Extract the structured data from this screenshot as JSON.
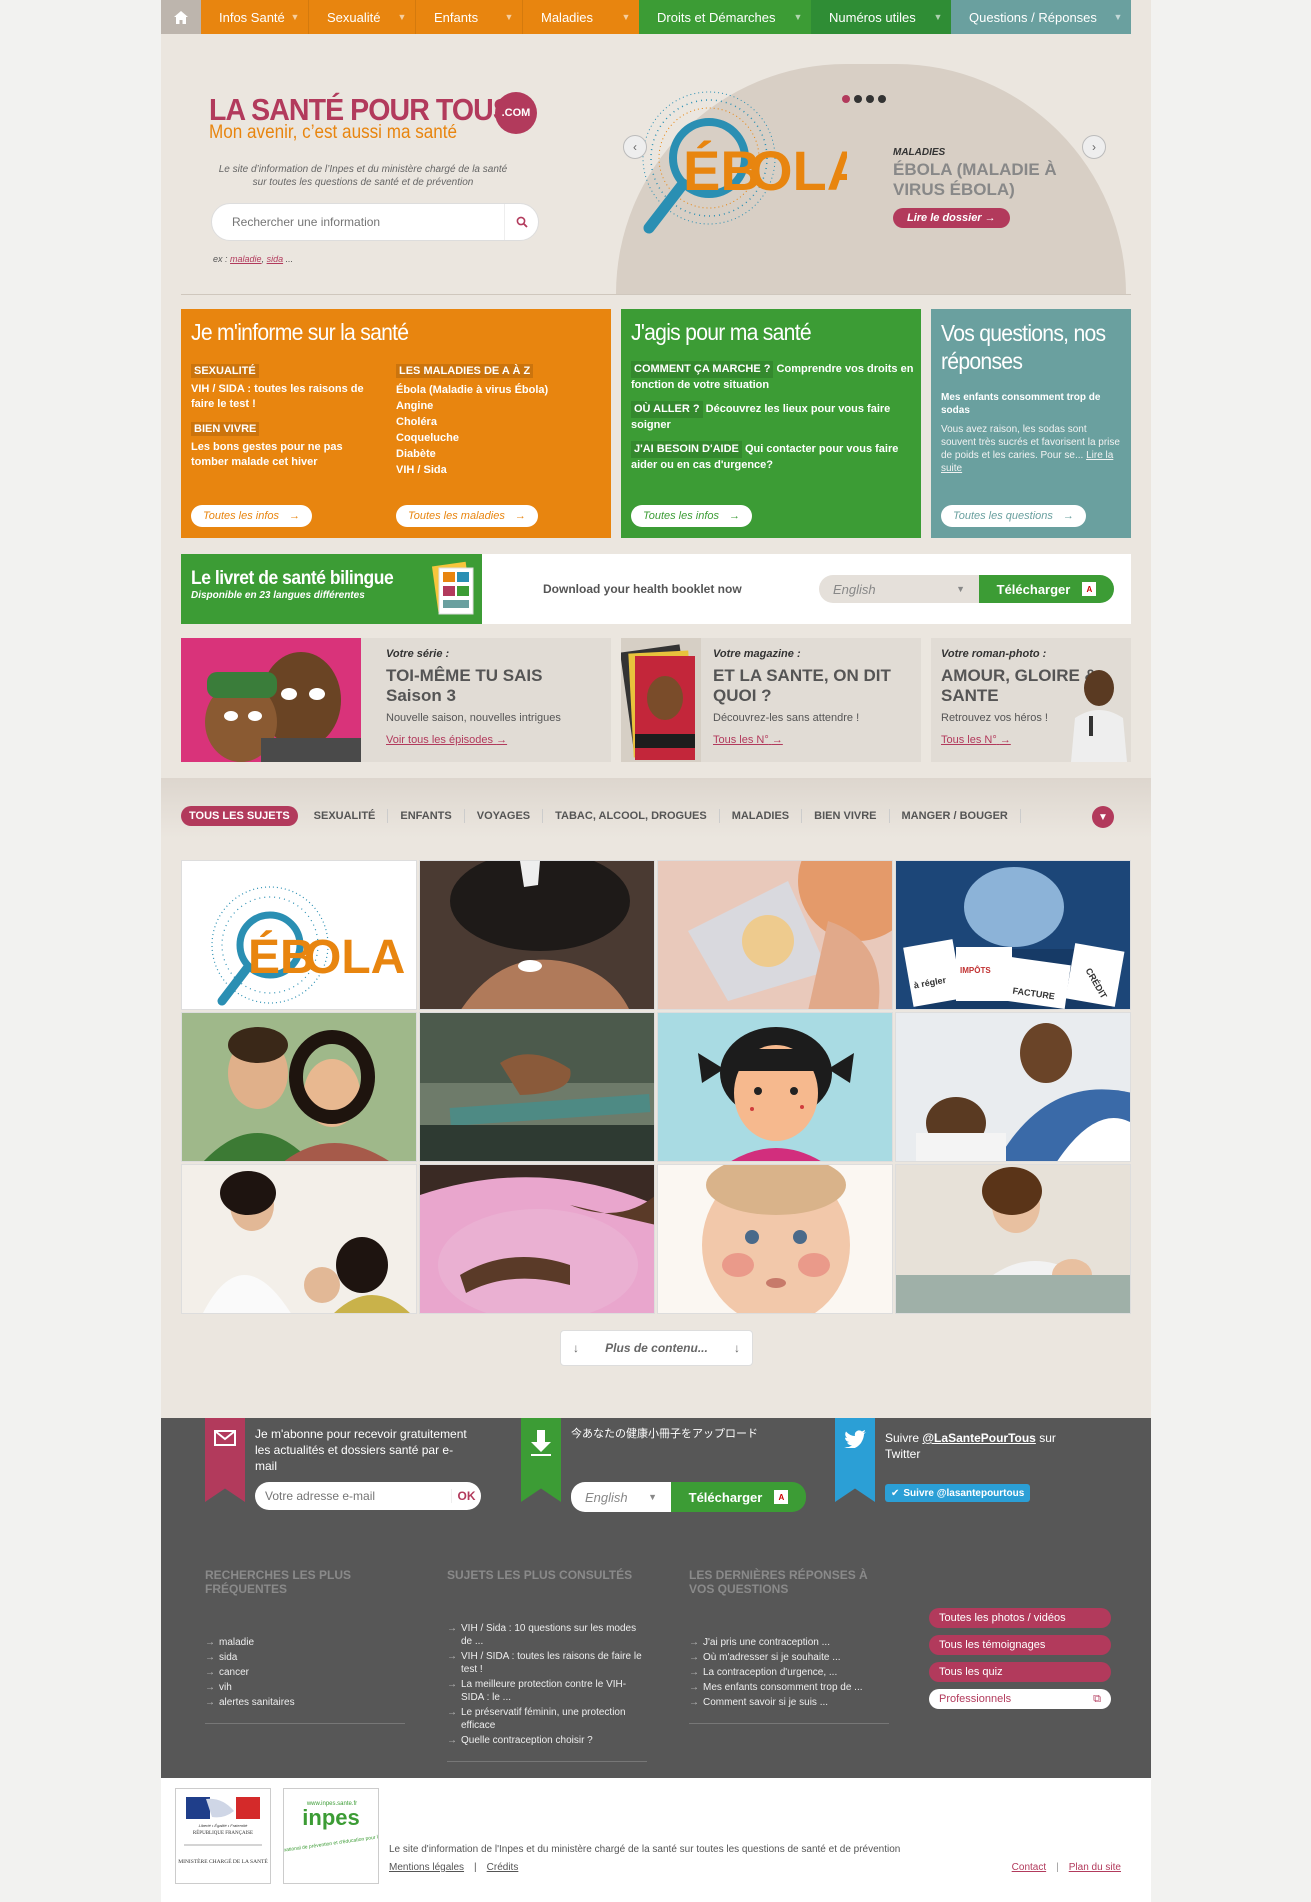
{
  "nav": {
    "items": [
      {
        "label": "Infos Santé",
        "color": "#e8850f"
      },
      {
        "label": "Sexualité",
        "color": "#e8850f"
      },
      {
        "label": "Enfants",
        "color": "#e8850f"
      },
      {
        "label": "Maladies",
        "color": "#e8850f"
      },
      {
        "label": "Droits et Démarches",
        "color": "#3c9c35"
      },
      {
        "label": "Numéros utiles",
        "color": "#2f8d35"
      },
      {
        "label": "Questions / Réponses",
        "color": "#6aa09f"
      }
    ]
  },
  "header": {
    "title": "LA SANTÉ POUR TOUS",
    "com": ".COM",
    "subtitle": "Mon avenir, c’est aussi ma santé",
    "tagline": "Le site d’information de l’Inpes et du ministère chargé de la santé sur toutes les questions de santé et de prévention",
    "search_placeholder": "Rechercher une information",
    "examples_prefix": "ex :",
    "example_1": "maladie",
    "example_2": "sida",
    "examples_suffix": "...",
    "hero": {
      "image_word_1": "ÉB",
      "image_word_2": "OLA",
      "kicker": "MALADIES",
      "title": "ÉBOLA (MALADIE À VIRUS ÉBOLA)",
      "cta": "Lire le dossier →"
    }
  },
  "blocks": {
    "inform": {
      "title": "Je m'informe sur la santé",
      "tag1": "SEXUALITÉ",
      "text1": "VIH / SIDA : toutes les raisons de faire le test !",
      "tag2": "BIEN VIVRE",
      "text2": "Les bons gestes pour ne pas tomber malade cet hiver",
      "tag3": "LES MALADIES DE A À Z",
      "diseases": [
        "Ébola (Maladie à virus Ébola)",
        "Angine",
        "Choléra",
        "Coqueluche",
        "Diabète",
        "VIH / Sida"
      ],
      "btn1": "Toutes les infos",
      "btn2": "Toutes les maladies"
    },
    "act": {
      "title": "J'agis pour ma santé",
      "tag1": "COMMENT ÇA MARCHE ?",
      "text1": "Comprendre vos droits en fonction de votre situation",
      "tag2": "OÙ ALLER ?",
      "text2": "Découvrez les lieux pour vous faire soigner",
      "tag3": "J'AI BESOIN D'AIDE",
      "text3": "Qui contacter pour vous faire aider ou en cas d'urgence?",
      "btn": "Toutes les infos"
    },
    "questions": {
      "title": "Vos questions, nos réponses",
      "question": "Mes enfants consomment trop de sodas",
      "answer": "Vous avez raison, les sodas sont souvent très sucrés et favorisent la prise de poids et les caries. Pour se...",
      "more": "Lire la suite",
      "btn": "Toutes les questions"
    }
  },
  "livret": {
    "title": "Le livret de santé bilingue",
    "subtitle": "Disponible en 23 langues différentes",
    "download_text": "Download your health booklet now",
    "language": "English",
    "button": "Télécharger"
  },
  "series": [
    {
      "kicker": "Votre série :",
      "title": "TOI-MÊME TU SAIS Saison 3",
      "desc": "Nouvelle saison, nouvelles intrigues",
      "link": "Voir tous les épisodes"
    },
    {
      "kicker": "Votre magazine :",
      "title": "ET LA SANTE, ON DIT QUOI ?",
      "desc": "Découvrez-les sans attendre !",
      "link": "Tous les N°"
    },
    {
      "kicker": "Votre roman-photo :",
      "title": "AMOUR, GLOIRE & SANTE",
      "desc": "Retrouvez vos héros !",
      "link": "Tous les N°"
    }
  ],
  "topics": [
    "TOUS LES SUJETS",
    "SEXUALITÉ",
    "ENFANTS",
    "VOYAGES",
    "TABAC, ALCOOL, DROGUES",
    "MALADIES",
    "BIEN VIVRE",
    "MANGER / BOUGER"
  ],
  "grid": {
    "tile_word_1": "ÉB",
    "tile_word_2": "OLA",
    "note_1": "à régler",
    "note_2": "IMPÔTS",
    "note_3": "FACTURE",
    "note_4": "CRÉDIT"
  },
  "more": "Plus de contenu...",
  "footer": {
    "newsletter": "Je m'abonne pour recevoir gratuitement les actualités et dossiers santé par e-mail",
    "email_placeholder": "Votre adresse e-mail",
    "ok": "OK",
    "booklet_text": "今あなたの健康小冊子をアップロード",
    "language": "English",
    "download": "Télécharger",
    "twitter_prefix": "Suivre",
    "twitter_handle": "@LaSantePourTous",
    "twitter_suffix": "sur Twitter",
    "twitter_btn": "Suivre @lasantepourtous",
    "col1_title": "Recherches les plus fréquentes",
    "col1": [
      "maladie",
      "sida",
      "cancer",
      "vih",
      "alertes sanitaires"
    ],
    "col2_title": "Sujets les plus consultés",
    "col2": [
      "VIH / Sida : 10 questions sur les modes de ...",
      "VIH / SIDA : toutes les raisons de faire le test !",
      "La meilleure protection contre le VIH-SIDA : le ...",
      "Le préservatif féminin, une protection efficace",
      "Quelle contraception choisir ?"
    ],
    "col3_title": "Les dernières réponses à vos questions",
    "col3": [
      "J'ai pris une contraception ...",
      "Où m'adresser si je souhaite ...",
      "La contraception d'urgence, ...",
      "Mes enfants consomment trop de ...",
      "Comment savoir si je suis ..."
    ],
    "buttons": [
      "Toutes les photos / vidéos",
      "Tous les témoignages",
      "Tous les quiz"
    ],
    "pro": "Professionnels"
  },
  "bottom": {
    "republique_motto": "Liberté • Égalité • Fraternité",
    "republique": "RÉPUBLIQUE FRANÇAISE",
    "ministere": "MINISTÈRE CHARGÉ DE LA SANTÉ",
    "inpes_url": "www.inpes.sante.fr",
    "inpes": "inpes",
    "inpes_desc": "Institut national de prévention et d'éducation pour la santé",
    "legal": "Le site d'information de l'Inpes et du ministère chargé de la santé sur toutes les questions de santé et de prévention",
    "mentions": "Mentions légales",
    "credits": "Crédits",
    "contact": "Contact",
    "plan": "Plan du site"
  }
}
